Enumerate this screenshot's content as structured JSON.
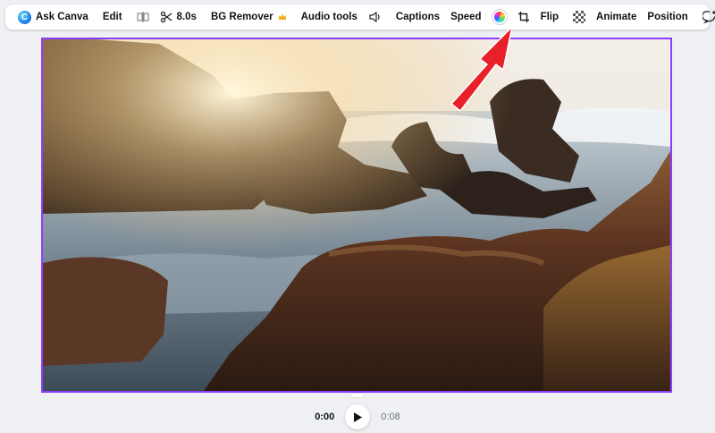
{
  "toolbar": {
    "ask_canva": "Ask Canva",
    "edit": "Edit",
    "duration": "8.0s",
    "bg_remover": "BG Remover",
    "audio_tools": "Audio tools",
    "captions": "Captions",
    "speed": "Speed",
    "flip": "Flip",
    "animate": "Animate",
    "position": "Position"
  },
  "icons": {
    "logo": "canva-logo-icon",
    "split": "split-icon",
    "trim": "scissors-icon",
    "premium": "crown-icon",
    "volume": "speaker-icon",
    "color": "color-wheel-icon",
    "crop": "crop-icon",
    "transparency": "transparency-icon",
    "comment": "comment-add-icon",
    "delete": "trash-icon"
  },
  "colors": {
    "selection": "#8b3dff",
    "annotation_arrow": "#e8202a"
  },
  "playback": {
    "current": "0:00",
    "total": "0:08"
  }
}
